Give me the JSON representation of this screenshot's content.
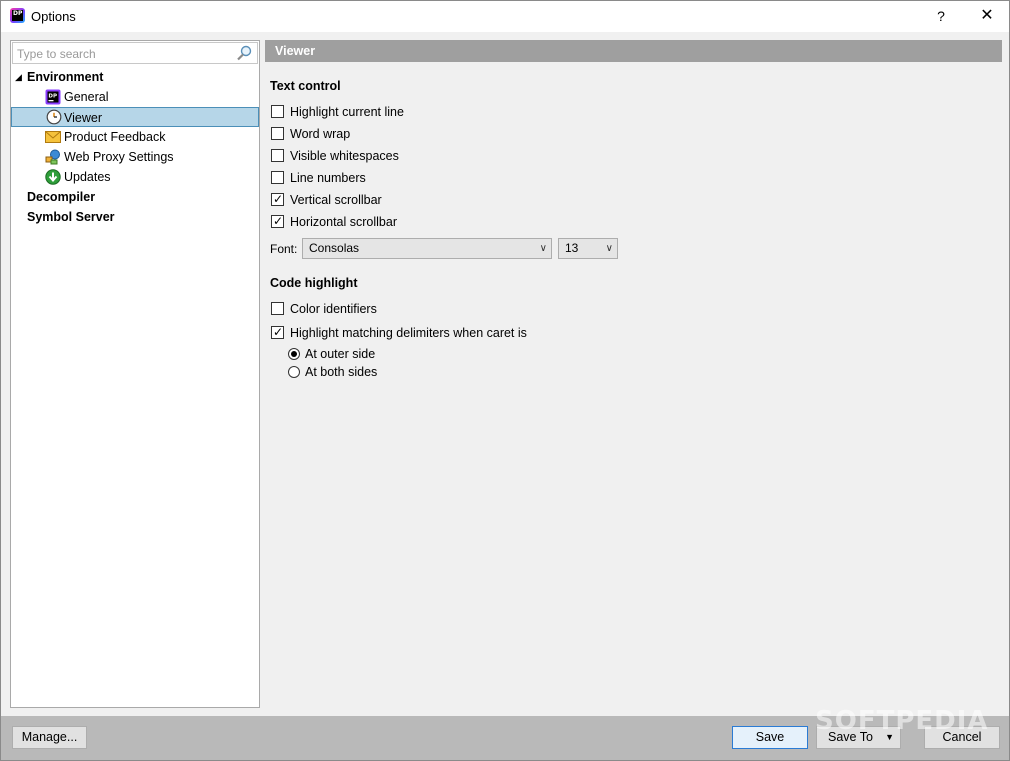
{
  "window": {
    "title": "Options",
    "help_label": "?",
    "close_label": "✕",
    "app_icon_text": "DP"
  },
  "sidebar": {
    "search_placeholder": "Type to search",
    "groups": [
      {
        "label": "Environment",
        "expander": "◢",
        "items": [
          {
            "label": "General",
            "icon": "dotpeek-icon"
          },
          {
            "label": "Viewer",
            "icon": "viewer-clock-icon",
            "selected": true
          },
          {
            "label": "Product Feedback",
            "icon": "envelope-icon"
          },
          {
            "label": "Web Proxy Settings",
            "icon": "proxy-network-icon"
          },
          {
            "label": "Updates",
            "icon": "download-update-icon"
          }
        ]
      },
      {
        "label": "Decompiler"
      },
      {
        "label": "Symbol Server"
      }
    ]
  },
  "main": {
    "header": "Viewer",
    "text_control": {
      "title": "Text control",
      "options": [
        {
          "label": "Highlight current line",
          "checked": false
        },
        {
          "label": "Word wrap",
          "checked": false
        },
        {
          "label": "Visible whitespaces",
          "checked": false
        },
        {
          "label": "Line numbers",
          "checked": false
        },
        {
          "label": "Vertical scrollbar",
          "checked": true
        },
        {
          "label": "Horizontal scrollbar",
          "checked": true
        }
      ],
      "font_label": "Font:",
      "font_value": "Consolas",
      "size_value": "13"
    },
    "code_highlight": {
      "title": "Code highlight",
      "color_identifiers": {
        "label": "Color identifiers",
        "checked": false
      },
      "highlight_delimiters": {
        "label": "Highlight matching delimiters when caret is",
        "checked": true
      },
      "radio_outer": {
        "label": "At outer side",
        "selected": true
      },
      "radio_both": {
        "label": "At both sides",
        "selected": false
      }
    }
  },
  "footer": {
    "manage_label": "Manage...",
    "save_label": "Save",
    "save_to_label": "Save To",
    "cancel_label": "Cancel",
    "watermark": "SOFTPEDIA"
  },
  "colors": {
    "selection_bg": "#b6d6e8",
    "selection_border": "#4b8fb8",
    "header_bg": "#9f9f9f",
    "footer_bg": "#b9b9b9"
  }
}
